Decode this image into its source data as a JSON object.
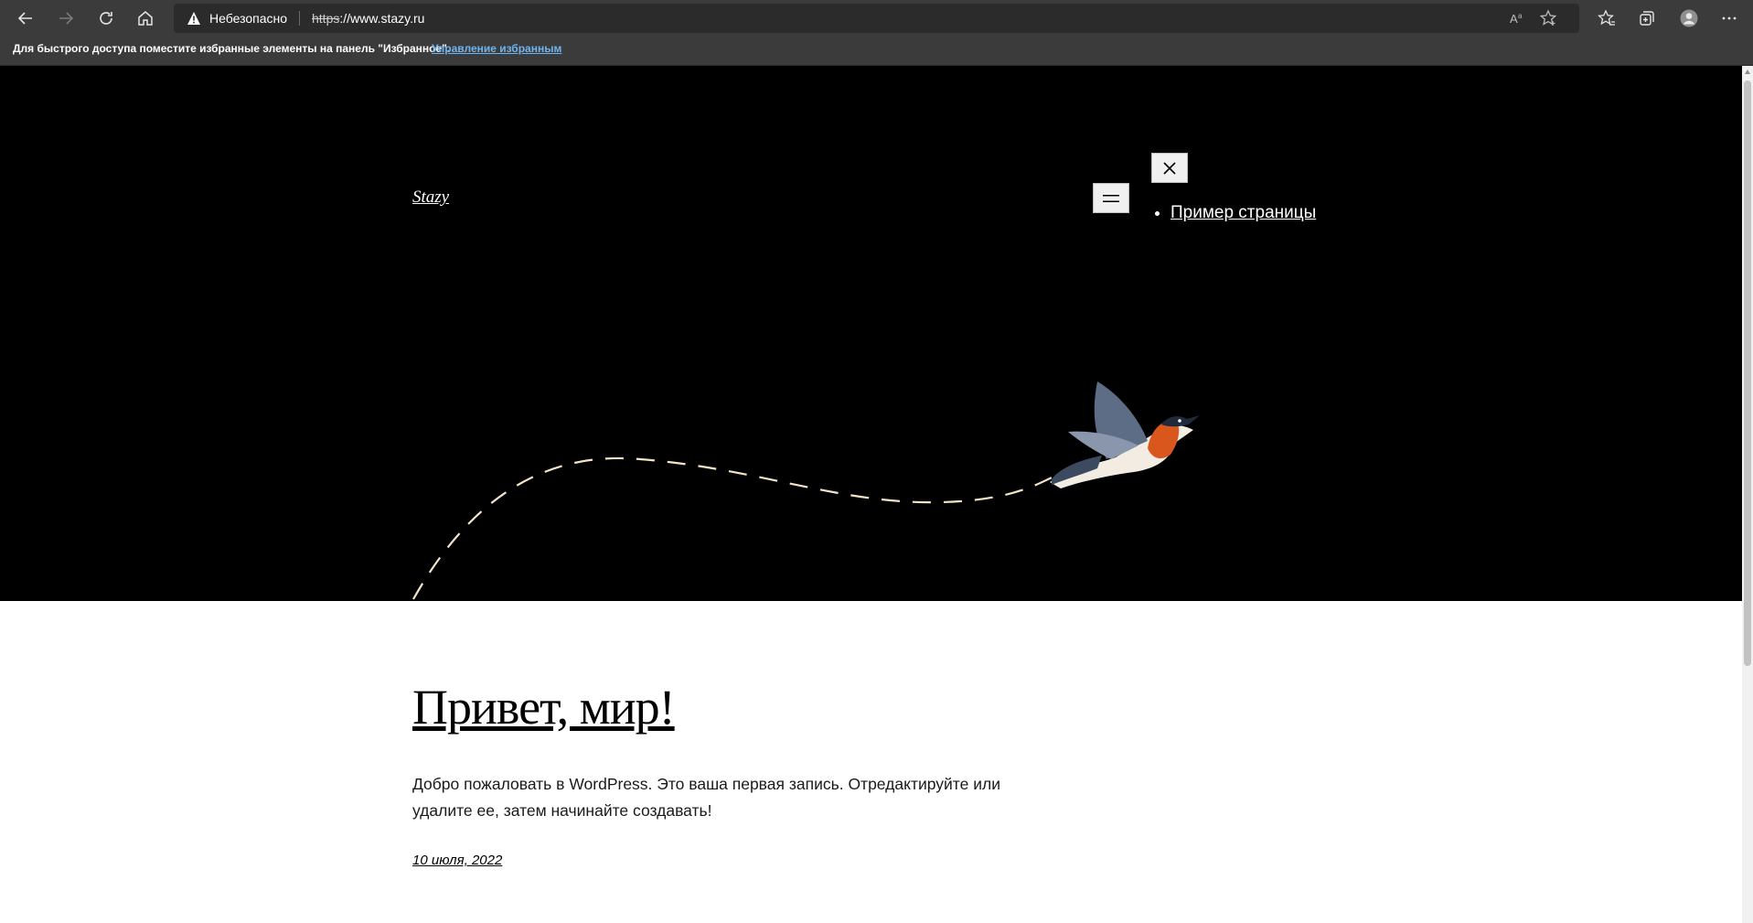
{
  "browser": {
    "security_label": "Небезопасно",
    "url_scheme": "https",
    "url_rest": "://www.stazy.ru",
    "favorites_bar": {
      "message": "Для быстрого доступа поместите избранные элементы на панель \"Избранное\".",
      "link": "Управление избранным"
    },
    "icons": [
      "back-icon",
      "forward-icon",
      "refresh-icon",
      "home-icon",
      "warning-icon",
      "read-aloud-icon",
      "add-favorite-icon",
      "favorites-icon",
      "collections-icon",
      "profile-icon",
      "more-icon"
    ]
  },
  "site": {
    "title": "Stazy",
    "nav_items": [
      "Пример страницы"
    ],
    "header_bg": "#000000"
  },
  "post": {
    "title": "Привет, мир!",
    "body": "Добро пожаловать в WordPress. Это ваша первая запись. Отредактируйте или удалите ее, затем начинайте создавать!",
    "date": "10 июля, 2022"
  }
}
